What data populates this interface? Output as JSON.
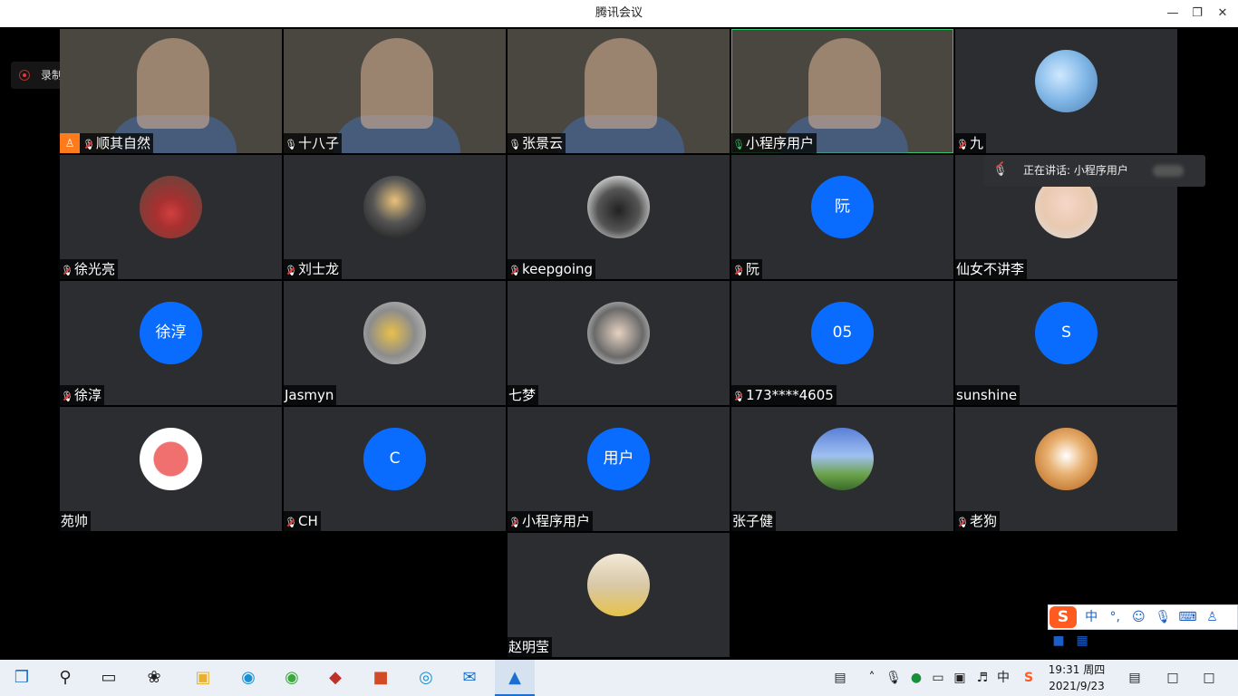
{
  "window": {
    "title": "腾讯会议",
    "minimize_icon": "minimize-icon",
    "restore_icon": "restore-icon",
    "close_icon": "close-icon"
  },
  "recording": {
    "label": "录制中"
  },
  "speaking": {
    "label": "正在讲话: 小程序用户"
  },
  "participants": [
    {
      "name": "顺其自然",
      "mic": "muted",
      "host": true,
      "video": true
    },
    {
      "name": "十八子",
      "mic": "on",
      "video": true
    },
    {
      "name": "张景云",
      "mic": "on",
      "video": true
    },
    {
      "name": "小程序用户",
      "mic": "speaking",
      "video": true
    },
    {
      "name": "九",
      "mic": "muted"
    },
    {
      "name": "徐光亮",
      "mic": "muted"
    },
    {
      "name": "刘士龙",
      "mic": "muted"
    },
    {
      "name": "keepgoing",
      "mic": "muted"
    },
    {
      "name": "阮",
      "mic": "muted",
      "avatar_text": "阮"
    },
    {
      "name": "仙女不讲李",
      "mic": "none"
    },
    {
      "name": "徐淳",
      "mic": "muted",
      "avatar_text": "徐淳"
    },
    {
      "name": "Jasmyn",
      "mic": "none"
    },
    {
      "name": "七梦",
      "mic": "none"
    },
    {
      "name": "173****4605",
      "mic": "muted",
      "avatar_text": "05"
    },
    {
      "name": "sunshine",
      "mic": "none",
      "avatar_text": "S"
    },
    {
      "name": "苑帅",
      "mic": "none"
    },
    {
      "name": "CH",
      "mic": "muted",
      "avatar_text": "C"
    },
    {
      "name": "小程序用户",
      "mic": "muted",
      "avatar_text": "用户"
    },
    {
      "name": "张子健",
      "mic": "none"
    },
    {
      "name": "老狗",
      "mic": "muted"
    },
    {
      "name": "赵明莹",
      "mic": "none"
    }
  ],
  "ime": {
    "logo": "S",
    "mode": "中",
    "punct": "°,",
    "items": [
      "emoji-icon",
      "mic-icon",
      "keyboard-icon",
      "user-icon",
      "shirt-icon",
      "grid-icon"
    ]
  },
  "taskbar": {
    "apps": [
      "start-icon",
      "search-icon",
      "task-view-icon",
      "pinwheel-icon",
      "file-explorer-icon",
      "edge-icon",
      "browser-icon",
      "game-icon",
      "powerpoint-icon",
      "edge-dev-icon",
      "mail-icon",
      "tencent-meeting-icon"
    ],
    "tray_lang": "中",
    "time": "19:31 周四",
    "date": "2021/9/23"
  }
}
